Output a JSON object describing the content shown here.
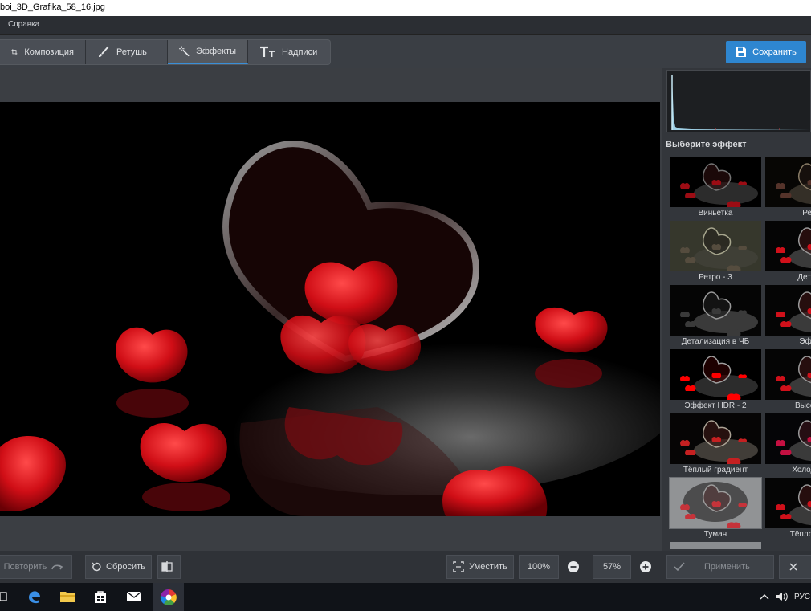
{
  "window": {
    "title": "boi_3D_Grafika_58_16.jpg"
  },
  "menu": {
    "items": [
      "Справка"
    ]
  },
  "toolbar": {
    "tabs": [
      {
        "label": "Композиция",
        "icon": "crop-icon"
      },
      {
        "label": "Ретушь",
        "icon": "brush-icon"
      },
      {
        "label": "Эффекты",
        "icon": "magic-wand-icon",
        "active": true
      },
      {
        "label": "Надписи",
        "icon": "text-icon"
      }
    ],
    "save_label": "Сохранить"
  },
  "effects_panel": {
    "title": "Выберите эффект",
    "items": [
      {
        "label": "Виньетка",
        "tone": "dark"
      },
      {
        "label": "Ретр",
        "tone": "sepia"
      },
      {
        "label": "Ретро - 3",
        "tone": "olive"
      },
      {
        "label": "Детали",
        "tone": "normal"
      },
      {
        "label": "Детализация в ЧБ",
        "tone": "bw"
      },
      {
        "label": "Эффе",
        "tone": "normal"
      },
      {
        "label": "Эффект HDR - 2",
        "tone": "vivid"
      },
      {
        "label": "Высокий",
        "tone": "normal"
      },
      {
        "label": "Тёплый градиент",
        "tone": "warm"
      },
      {
        "label": "Холодный",
        "tone": "cool"
      },
      {
        "label": "Туман",
        "tone": "fog"
      },
      {
        "label": "Тёплое тон",
        "tone": "normal"
      }
    ]
  },
  "bottom": {
    "redo_label": "Повторить",
    "reset_label": "Сбросить",
    "fit_label": "Уместить",
    "zoom_100": "100%",
    "zoom_value": "57%",
    "apply_label": "Применить"
  },
  "taskbar": {
    "apps": [
      "task-view-icon",
      "edge-icon",
      "file-explorer-icon",
      "store-icon",
      "mail-icon",
      "photo-editor-icon"
    ],
    "tray_lang": "РУС"
  },
  "colors": {
    "accent": "#2e86d0",
    "heart_red": "#d0101a",
    "panel_bg": "#33363b"
  }
}
